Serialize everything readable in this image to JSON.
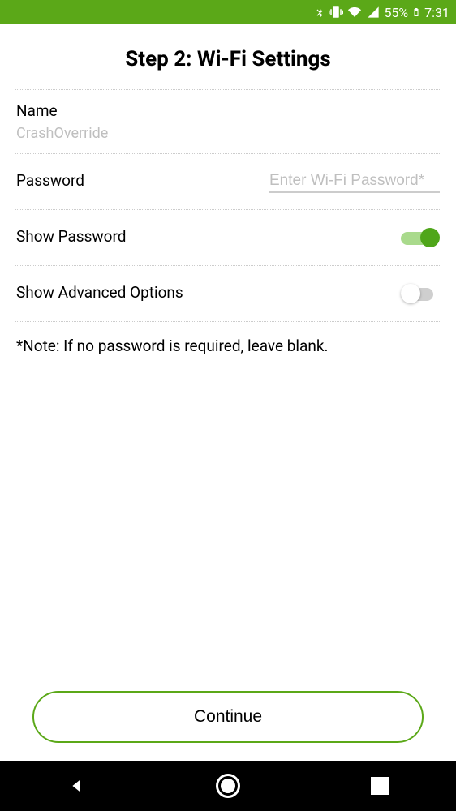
{
  "status": {
    "battery_pct": "55%",
    "time": "7:31"
  },
  "title": "Step 2: Wi-Fi Settings",
  "name_section": {
    "label": "Name",
    "value": "CrashOverride"
  },
  "password_section": {
    "label": "Password",
    "placeholder": "Enter Wi-Fi Password*",
    "value": ""
  },
  "show_password": {
    "label": "Show Password",
    "on": true
  },
  "show_advanced": {
    "label": "Show Advanced Options",
    "on": false
  },
  "note": "*Note: If no password is required, leave blank.",
  "continue_label": "Continue"
}
